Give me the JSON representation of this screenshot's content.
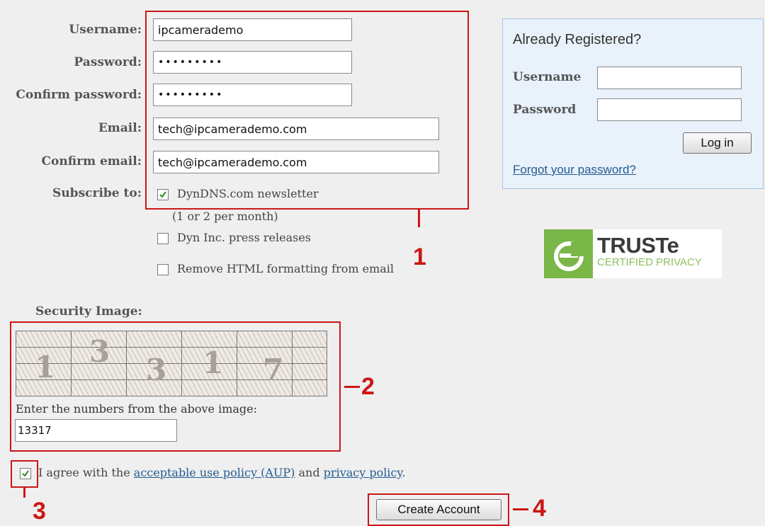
{
  "form": {
    "username_label": "Username:",
    "username_value": "ipcamerademo",
    "password_label": "Password:",
    "password_value": "•••••••••",
    "confirm_password_label": "Confirm password:",
    "confirm_password_value": "•••••••••",
    "email_label": "Email:",
    "email_value": "tech@ipcamerademo.com",
    "confirm_email_label": "Confirm email:",
    "confirm_email_value": "tech@ipcamerademo.com",
    "subscribe_label": "Subscribe to:",
    "newsletter_label": "DynDNS.com newsletter",
    "newsletter_note": "(1 or 2 per month)",
    "press_label": "Dyn Inc. press releases",
    "html_label": "Remove HTML formatting from email",
    "security_label": "Security Image:",
    "captcha_digits": [
      "1",
      "3",
      "3",
      "1",
      "7"
    ],
    "captcha_prompt": "Enter the numbers from the above image:",
    "captcha_value": "13317",
    "agree_prefix": "I agree with the",
    "aup_link": "acceptable use policy (AUP)",
    "agree_and": "and",
    "privacy_link": "privacy policy",
    "agree_suffix": ".",
    "create_button": "Create Account"
  },
  "login": {
    "title": "Already Registered?",
    "username_label": "Username",
    "password_label": "Password",
    "login_button": "Log in",
    "forgot_link": "Forgot your password?"
  },
  "truste": {
    "name": "TRUSTe",
    "tagline": "CERTIFIED PRIVACY",
    "green": "#7ab648"
  },
  "annotations": [
    "1",
    "2",
    "3",
    "4"
  ],
  "colors": {
    "annotation_red": "#cc1616",
    "link_blue": "#225d92",
    "panel_bg": "#e9f1fa",
    "check_green": "#2e8b22"
  }
}
